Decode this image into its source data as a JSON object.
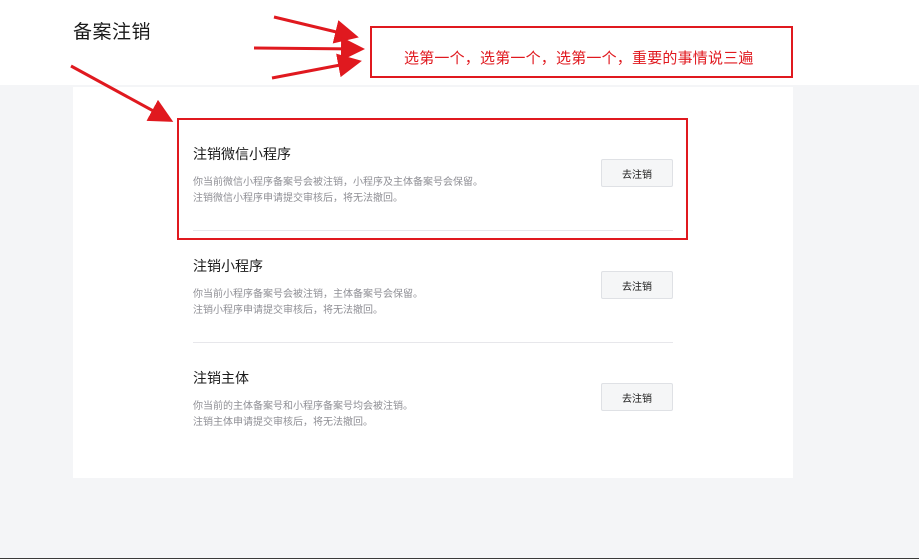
{
  "page": {
    "title": "备案注销"
  },
  "annotation": {
    "text": "选第一个，选第一个，选第一个，重要的事情说三遍"
  },
  "options": [
    {
      "title": "注销微信小程序",
      "description_line1": "你当前微信小程序备案号会被注销，小程序及主体备案号会保留。",
      "description_line2": "注销微信小程序申请提交审核后，将无法撤回。",
      "button_label": "去注销"
    },
    {
      "title": "注销小程序",
      "description_line1": "你当前小程序备案号会被注销，主体备案号会保留。",
      "description_line2": "注销小程序申请提交审核后，将无法撤回。",
      "button_label": "去注销"
    },
    {
      "title": "注销主体",
      "description_line1": "你当前的主体备案号和小程序备案号均会被注销。",
      "description_line2": "注销主体申请提交审核后，将无法撤回。",
      "button_label": "去注销"
    }
  ],
  "colors": {
    "annotation_red": "#e0191f",
    "page_background": "#f4f5f7",
    "card_background": "#ffffff",
    "description_gray": "#8f8f95"
  }
}
